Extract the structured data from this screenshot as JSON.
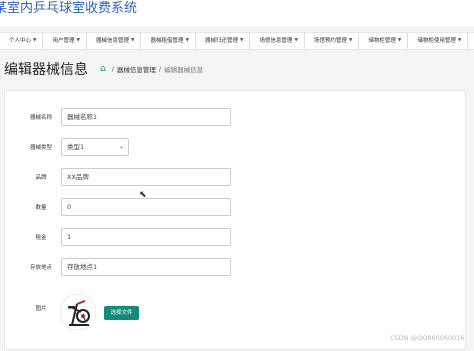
{
  "app": {
    "title": "某室内乒乓球室收费系统"
  },
  "nav": [
    "个人中心",
    "用户管理",
    "器械信息管理",
    "器械租借管理",
    "器械归还管理",
    "场馆信息管理",
    "场馆预约管理",
    "储物柜管理",
    "储物柜使用管理",
    "..."
  ],
  "page": {
    "title": "编辑器械信息",
    "breadcrumb": {
      "section": "器械信息管理",
      "current": "编辑器械信息"
    }
  },
  "form": {
    "name": {
      "label": "器械名称",
      "value": "器械名称1"
    },
    "type": {
      "label": "器械类型",
      "value": "类型1"
    },
    "brand": {
      "label": "品牌",
      "value": "XX品牌"
    },
    "quantity": {
      "label": "数量",
      "value": "0"
    },
    "rent": {
      "label": "租金",
      "value": "1"
    },
    "location": {
      "label": "存放地点",
      "value": "存放地点1"
    },
    "image": {
      "label": "图片",
      "button": "选择文件"
    }
  },
  "watermark": "CSDN @QQ860060016",
  "colors": {
    "brand": "#2f63b8",
    "accent": "#138a7a"
  }
}
